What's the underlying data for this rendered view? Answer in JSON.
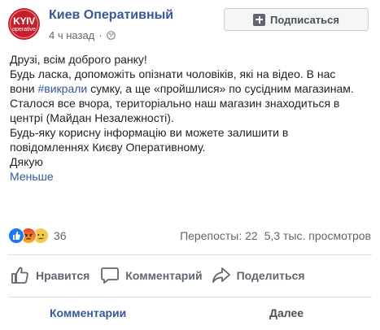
{
  "post": {
    "page_name": "Киев Оперативный",
    "avatar_text_top": "KYIV",
    "avatar_text_bottom": "operative",
    "time": "4 ч назад",
    "subscribe_label": "Подписаться",
    "body": {
      "line1": "Друзі, всім доброго ранку!",
      "line2": "Будь ласка, допоможіть опізнати чоловіків, які на відео. В нас",
      "line3_pre": "вони ",
      "line3_hashtag": "#викрали",
      "line3_post": " сумку, а ще «пройшлися» по сусідним магазинам.",
      "line4": "Сталося все вчора, територіально наш магазин знаходиться в",
      "line5": "центрі (Майдан Незалежності).",
      "line6": "Будь-яку корисну інформацію ви можете залишити в",
      "line7": "повідомленнях Києву Оперативному.",
      "line8": "Дякую",
      "less_link": "Меньше"
    },
    "reactions": {
      "icons": [
        "like-icon",
        "angry-icon",
        "sad-icon"
      ],
      "count": "36"
    },
    "stats": {
      "shares": "Перепосты: 22",
      "views": "5,3 тыс. просмотров"
    },
    "actions": {
      "like": "Нравится",
      "comment": "Комментарий",
      "share": "Поделиться"
    },
    "footer": {
      "comments": "Комментарии",
      "next": "Далее"
    }
  },
  "colors": {
    "link": "#385898",
    "secondary_text": "#606770",
    "brand_red": "#c4202b",
    "like_blue": "#1a78f2"
  }
}
